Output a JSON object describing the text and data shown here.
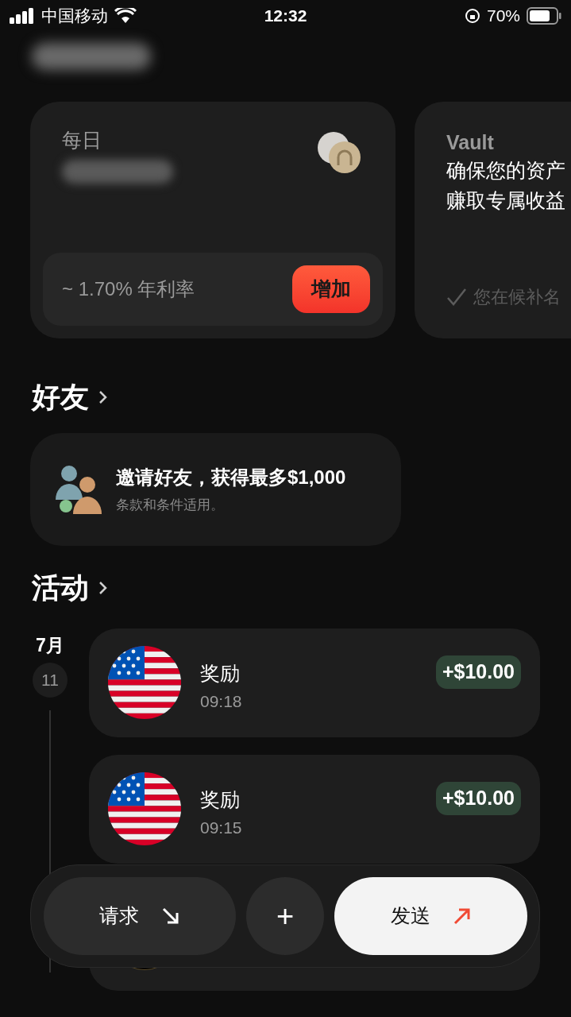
{
  "status_bar": {
    "carrier": "中国移动",
    "time": "12:32",
    "battery": "70%"
  },
  "savings_cards": [
    {
      "kind": "daily",
      "title": "每日",
      "rate": "~ 1.70% 年利率",
      "button": "增加"
    },
    {
      "kind": "vault",
      "title": "Vault",
      "lines": [
        "确保您的资产",
        "赚取专属收益"
      ],
      "waitlist": "您在候补名"
    }
  ],
  "friends": {
    "heading": "好友",
    "invite": {
      "title": "邀请好友，获得最多$1,000",
      "subtitle": "条款和条件适用。"
    }
  },
  "activity": {
    "heading": "活动",
    "month": "7月",
    "day": "11",
    "items": [
      {
        "title": "奖励",
        "time": "09:18",
        "amount": "+$10.00"
      },
      {
        "title": "奖励",
        "time": "09:15",
        "amount": "+$10.00"
      }
    ]
  },
  "actions": [
    {
      "kind": "request",
      "label": "请求"
    },
    {
      "kind": "add",
      "label": "+"
    },
    {
      "kind": "send",
      "label": "发送"
    }
  ]
}
